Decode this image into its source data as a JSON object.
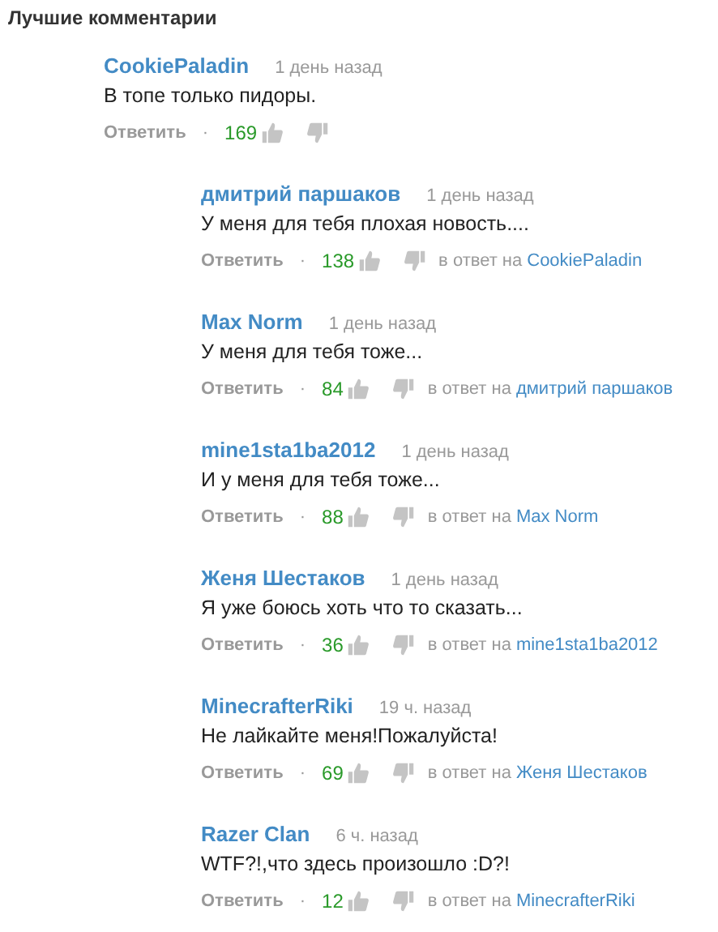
{
  "heading": "Лучшие комментарии",
  "comments": [
    {
      "author": "CookiePaladin",
      "time": "1 день назад",
      "text": "В топе только пидоры.",
      "reply_label": "Ответить",
      "separator": "·",
      "likes": "169",
      "replies": [
        {
          "author": "дмитрий паршаков",
          "time": "1 день назад",
          "text": "У меня для тебя плохая новость....",
          "reply_label": "Ответить",
          "separator": "·",
          "likes": "138",
          "in_reply_label": "в ответ на",
          "in_reply_to": "CookiePaladin"
        },
        {
          "author": "Max Norm",
          "time": "1 день назад",
          "text": "У меня для тебя тоже...",
          "reply_label": "Ответить",
          "separator": "·",
          "likes": "84",
          "in_reply_label": "в ответ на",
          "in_reply_to": "дмитрий паршаков"
        },
        {
          "author": "mine1sta1ba2012",
          "time": "1 день назад",
          "text": "И у меня для тебя тоже...",
          "reply_label": "Ответить",
          "separator": "·",
          "likes": "88",
          "in_reply_label": "в ответ на",
          "in_reply_to": "Max Norm"
        },
        {
          "author": "Женя Шестаков",
          "time": "1 день назад",
          "text": "Я уже боюсь хоть что то сказать...",
          "reply_label": "Ответить",
          "separator": "·",
          "likes": "36",
          "in_reply_label": "в ответ на",
          "in_reply_to": "mine1sta1ba2012"
        },
        {
          "author": "MinecrafterRiki",
          "time": "19 ч. назад",
          "text": "Не лайкайте меня!Пожалуйста!",
          "reply_label": "Ответить",
          "separator": "·",
          "likes": "69",
          "in_reply_label": "в ответ на",
          "in_reply_to": "Женя Шестаков"
        },
        {
          "author": "Razer Clan",
          "time": "6 ч. назад",
          "text": "WTF?!,что здесь произошло :D?!",
          "reply_label": "Ответить",
          "separator": "·",
          "likes": "12",
          "in_reply_label": "в ответ на",
          "in_reply_to": "MinecrafterRiki"
        }
      ]
    }
  ]
}
